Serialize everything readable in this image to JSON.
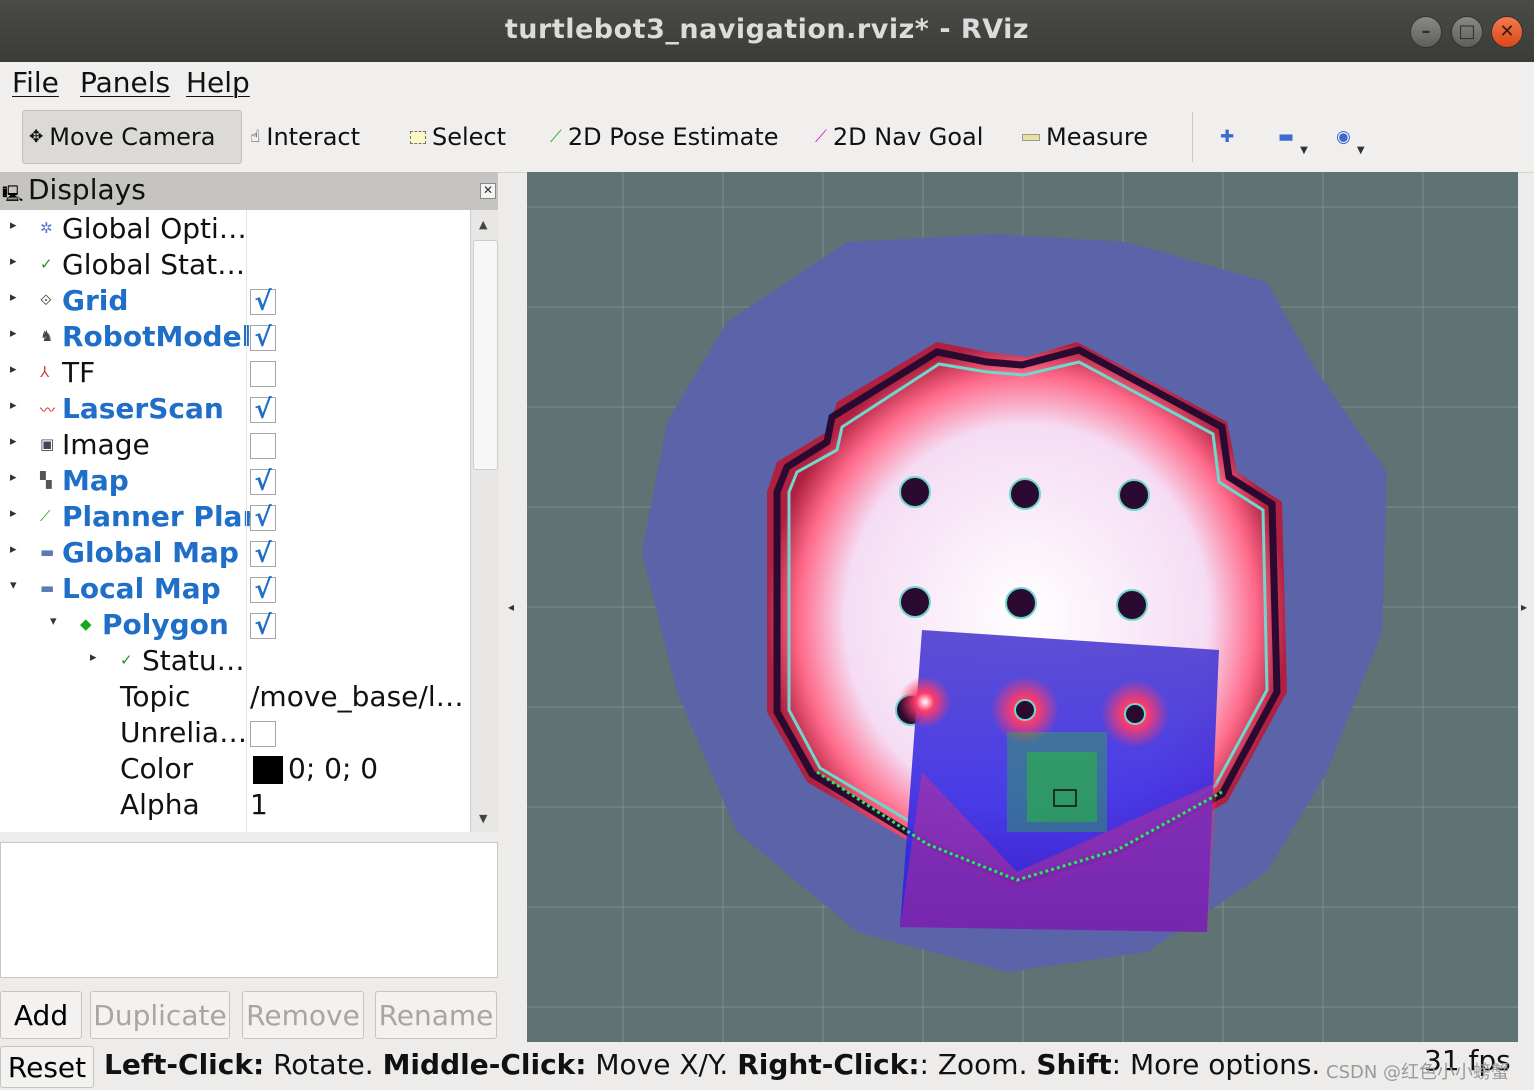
{
  "window": {
    "title": "turtlebot3_navigation.rviz* - RViz"
  },
  "menubar": {
    "file": "File",
    "panels": "Panels",
    "help": "Help"
  },
  "toolbar": {
    "move_camera": "Move Camera",
    "interact": "Interact",
    "select": "Select",
    "pose_estimate": "2D Pose Estimate",
    "nav_goal": "2D Nav Goal",
    "measure": "Measure"
  },
  "displays_panel": {
    "title": "Displays",
    "items": [
      {
        "label": "Global Opti…",
        "enabled": null
      },
      {
        "label": "Global Stat…",
        "enabled": null
      },
      {
        "label": "Grid",
        "enabled": true
      },
      {
        "label": "RobotModel",
        "enabled": true
      },
      {
        "label": "TF",
        "enabled": false
      },
      {
        "label": "LaserScan",
        "enabled": true
      },
      {
        "label": "Image",
        "enabled": false
      },
      {
        "label": "Map",
        "enabled": true
      },
      {
        "label": "Planner Plan",
        "enabled": true
      },
      {
        "label": "Global Map",
        "enabled": true
      },
      {
        "label": "Local Map",
        "enabled": true
      },
      {
        "label": "Polygon",
        "enabled": true
      },
      {
        "label": "Statu…",
        "enabled": null
      }
    ],
    "properties": {
      "topic_label": "Topic",
      "topic_value": "/move_base/l…",
      "unreliable_label": "Unrelia…",
      "color_label": "Color",
      "color_value": "0; 0; 0",
      "alpha_label": "Alpha",
      "alpha_value": "1"
    },
    "check_mark": "√"
  },
  "buttons": {
    "add": "Add",
    "duplicate": "Duplicate",
    "remove": "Remove",
    "rename": "Rename"
  },
  "statusbar": {
    "reset": "Reset",
    "help_left_key": "Left-Click:",
    "help_left_val": " Rotate. ",
    "help_middle_key": "Middle-Click:",
    "help_middle_val": " Move X/Y. ",
    "help_right_key": "Right-Click:",
    "help_right_val": ": Zoom. ",
    "help_shift_key": "Shift",
    "help_shift_val": ": More options.",
    "fps": "31 fps",
    "watermark": "CSDN @红色小小螃蟹"
  },
  "colors": {
    "viewport_bg": "#5f7374",
    "costmap_outer": "#5b63a9",
    "costmap_inner": "#f0d0ee",
    "obstacle": "#2a0a30",
    "local_costmap": "#3a2ee0",
    "path": "#00dd00",
    "enabled_text": "#1f6ec8"
  }
}
